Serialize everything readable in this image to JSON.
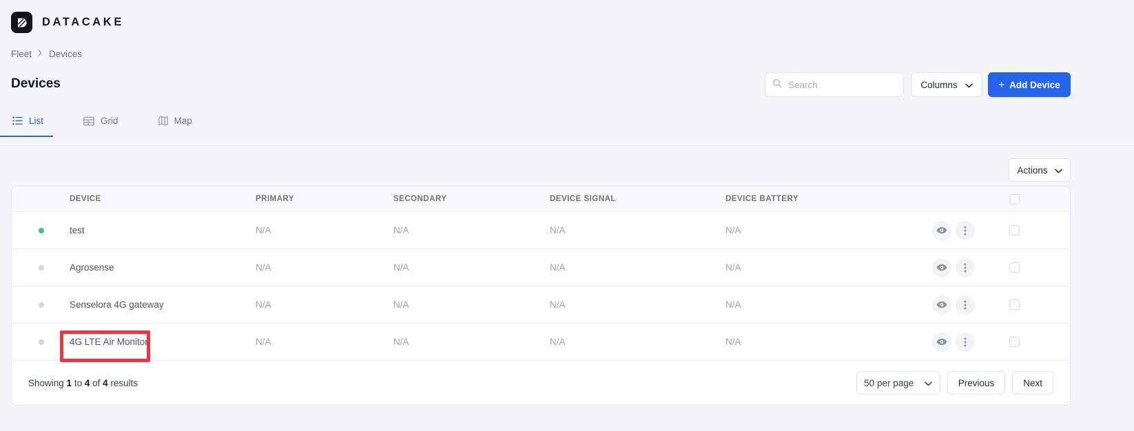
{
  "brand": {
    "name": "DATACAKE",
    "logo_icon": "datacake-logo-icon",
    "logo_color": "#111418"
  },
  "breadcrumb": {
    "items": [
      "Fleet",
      "Devices"
    ],
    "separator": "›"
  },
  "header": {
    "title": "Devices",
    "search": {
      "placeholder": "Search",
      "value": "",
      "icon": "search-icon"
    },
    "columns_button": {
      "label": "Columns",
      "icon": "chevron-down-icon"
    },
    "add_device_button": {
      "label": "Add Device",
      "plus": "+",
      "color": "#2563eb"
    }
  },
  "tabs": {
    "active": "List",
    "items": [
      {
        "label": "List",
        "icon": "list-icon",
        "active": true
      },
      {
        "label": "Grid",
        "icon": "grid-icon",
        "active": false
      },
      {
        "label": "Map",
        "icon": "map-icon",
        "active": false
      }
    ],
    "accent_color": "#2563eb"
  },
  "toolbar": {
    "actions_button": {
      "label": "Actions",
      "icon": "chevron-down-icon"
    }
  },
  "table": {
    "columns": [
      "DEVICE",
      "PRIMARY",
      "SECONDARY",
      "DEVICE SIGNAL",
      "DEVICE BATTERY"
    ],
    "select_all_checkbox": false,
    "rows": [
      {
        "status": "online",
        "status_color": "#2ecc71",
        "device": "test",
        "primary": "N/A",
        "secondary": "N/A",
        "device_signal": "N/A",
        "device_battery": "N/A",
        "view_icon": "eye-icon",
        "more_icon": "kebab-menu-icon",
        "checked": false
      },
      {
        "status": "offline",
        "status_color": "#d4d7dc",
        "device": "Agrosense",
        "primary": "N/A",
        "secondary": "N/A",
        "device_signal": "N/A",
        "device_battery": "N/A",
        "view_icon": "eye-icon",
        "more_icon": "kebab-menu-icon",
        "checked": false
      },
      {
        "status": "offline",
        "status_color": "#d4d7dc",
        "device": "Senselora 4G gateway",
        "primary": "N/A",
        "secondary": "N/A",
        "device_signal": "N/A",
        "device_battery": "N/A",
        "view_icon": "eye-icon",
        "more_icon": "kebab-menu-icon",
        "checked": false
      },
      {
        "status": "offline",
        "status_color": "#d4d7dc",
        "device": "4G LTE Air Monitor",
        "primary": "N/A",
        "secondary": "N/A",
        "device_signal": "N/A",
        "device_battery": "N/A",
        "view_icon": "eye-icon",
        "more_icon": "kebab-menu-icon",
        "checked": false
      }
    ]
  },
  "footer": {
    "showing_prefix": "Showing ",
    "showing_from": "1",
    "showing_mid": " to ",
    "showing_to": "4",
    "showing_of": " of ",
    "showing_total": "4",
    "showing_suffix": " results",
    "per_page": {
      "label": "50 per page",
      "icon": "chevron-down-icon"
    },
    "previous_button": "Previous",
    "next_button": "Next"
  },
  "annotation": {
    "target": "4G LTE Air Monitor",
    "color": "#f5333f"
  }
}
